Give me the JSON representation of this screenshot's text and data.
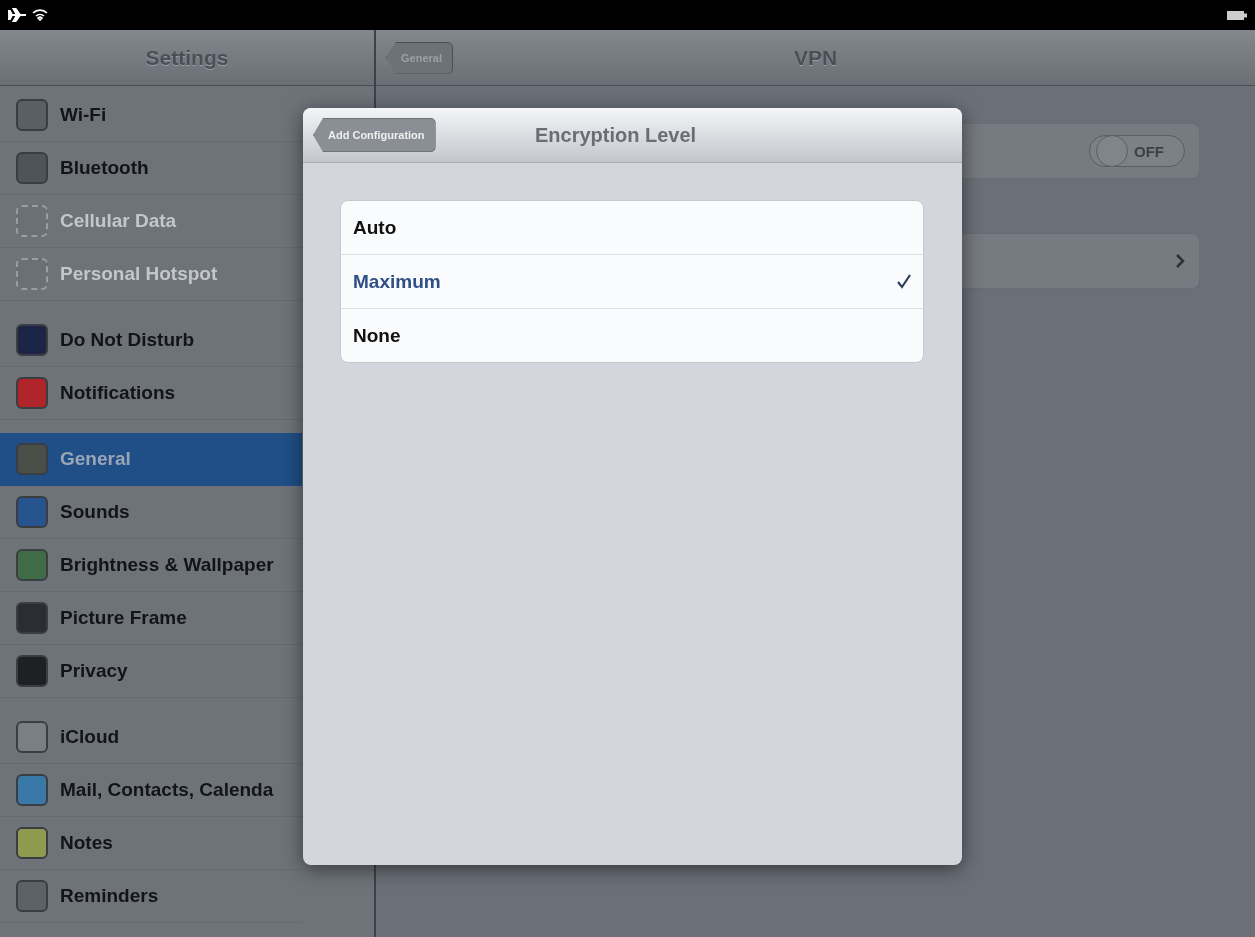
{
  "sidebar": {
    "title": "Settings",
    "groups": [
      {
        "items": [
          {
            "label": "Wi-Fi",
            "disabled": false,
            "selected": false,
            "color": "#5a5f66"
          },
          {
            "label": "Bluetooth",
            "disabled": false,
            "selected": false,
            "color": "#4f545b"
          },
          {
            "label": "Cellular Data",
            "disabled": true,
            "selected": false,
            "color": "#6b7077"
          },
          {
            "label": "Personal Hotspot",
            "disabled": true,
            "selected": false,
            "color": "#6b7077"
          }
        ]
      },
      {
        "items": [
          {
            "label": "Do Not Disturb",
            "disabled": false,
            "selected": false,
            "color": "#1c2448"
          },
          {
            "label": "Notifications",
            "disabled": false,
            "selected": false,
            "color": "#b0252a"
          }
        ]
      },
      {
        "items": [
          {
            "label": "General",
            "disabled": false,
            "selected": true,
            "color": "#4a4f48"
          },
          {
            "label": "Sounds",
            "disabled": false,
            "selected": false,
            "color": "#25548f"
          },
          {
            "label": "Brightness & Wallpaper",
            "disabled": false,
            "selected": false,
            "color": "#3f6b46"
          },
          {
            "label": "Picture Frame",
            "disabled": false,
            "selected": false,
            "color": "#2a2d31"
          },
          {
            "label": "Privacy",
            "disabled": false,
            "selected": false,
            "color": "#1e2023"
          }
        ]
      },
      {
        "items": [
          {
            "label": "iCloud",
            "disabled": false,
            "selected": false,
            "color": "#7a7f86"
          },
          {
            "label": "Mail, Contacts, Calenda",
            "disabled": false,
            "selected": false,
            "color": "#3a78a8"
          },
          {
            "label": "Notes",
            "disabled": false,
            "selected": false,
            "color": "#8f9a4e"
          },
          {
            "label": "Reminders",
            "disabled": false,
            "selected": false,
            "color": "#5c6067"
          }
        ]
      }
    ]
  },
  "detail": {
    "back": "General",
    "title": "VPN",
    "rows": [
      {
        "kind": "switch",
        "on": false,
        "label": "OFF"
      },
      {
        "kind": "disclosure"
      }
    ]
  },
  "popover": {
    "back": "Add Configuration",
    "title": "Encryption Level",
    "options": [
      {
        "label": "Auto",
        "selected": false
      },
      {
        "label": "Maximum",
        "selected": true
      },
      {
        "label": "None",
        "selected": false
      }
    ]
  }
}
